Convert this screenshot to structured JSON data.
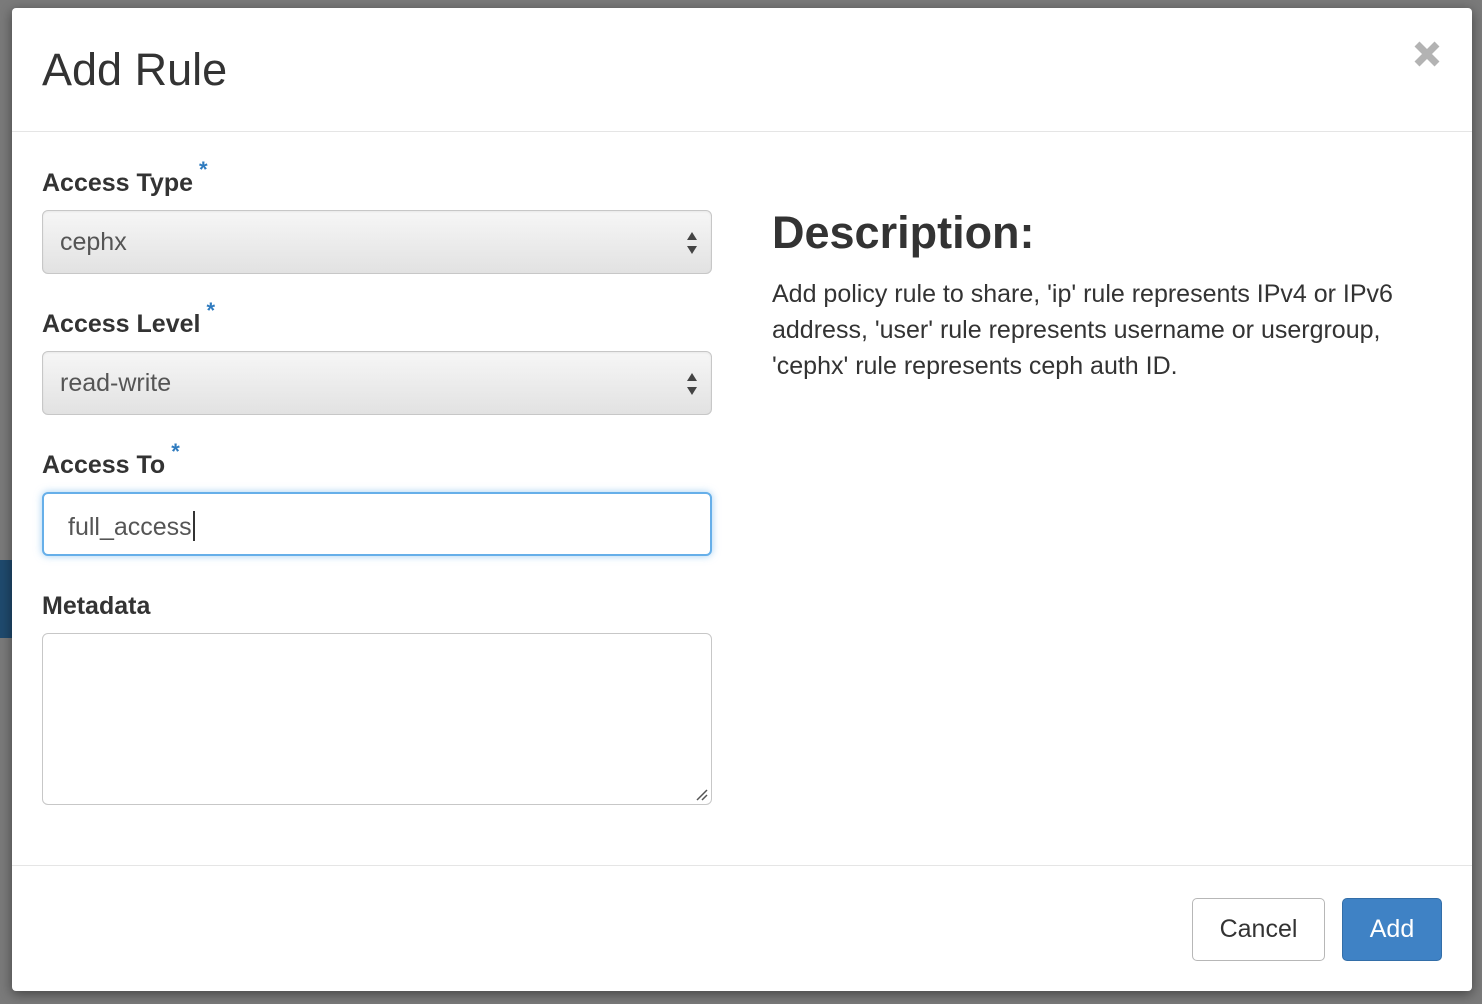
{
  "modal": {
    "title": "Add Rule"
  },
  "form": {
    "access_type": {
      "label": "Access Type",
      "required_marker": "*",
      "selected": "cephx"
    },
    "access_level": {
      "label": "Access Level",
      "required_marker": "*",
      "selected": "read-write"
    },
    "access_to": {
      "label": "Access To",
      "required_marker": "*",
      "value": "full_access"
    },
    "metadata": {
      "label": "Metadata",
      "value": ""
    }
  },
  "description": {
    "title": "Description:",
    "text": "Add policy rule to share, 'ip' rule represents IPv4 or IPv6 address, 'user' rule represents username or usergroup, 'cephx' rule represents ceph auth ID."
  },
  "footer": {
    "cancel_label": "Cancel",
    "add_label": "Add"
  },
  "icons": {
    "close": "close-icon",
    "select_arrows": "sort-arrows-icon",
    "resize": "resize-handle-icon"
  },
  "colors": {
    "primary_button": "#3f82c5",
    "required_marker": "#2f7bbf",
    "focus_border": "#66afe9"
  }
}
